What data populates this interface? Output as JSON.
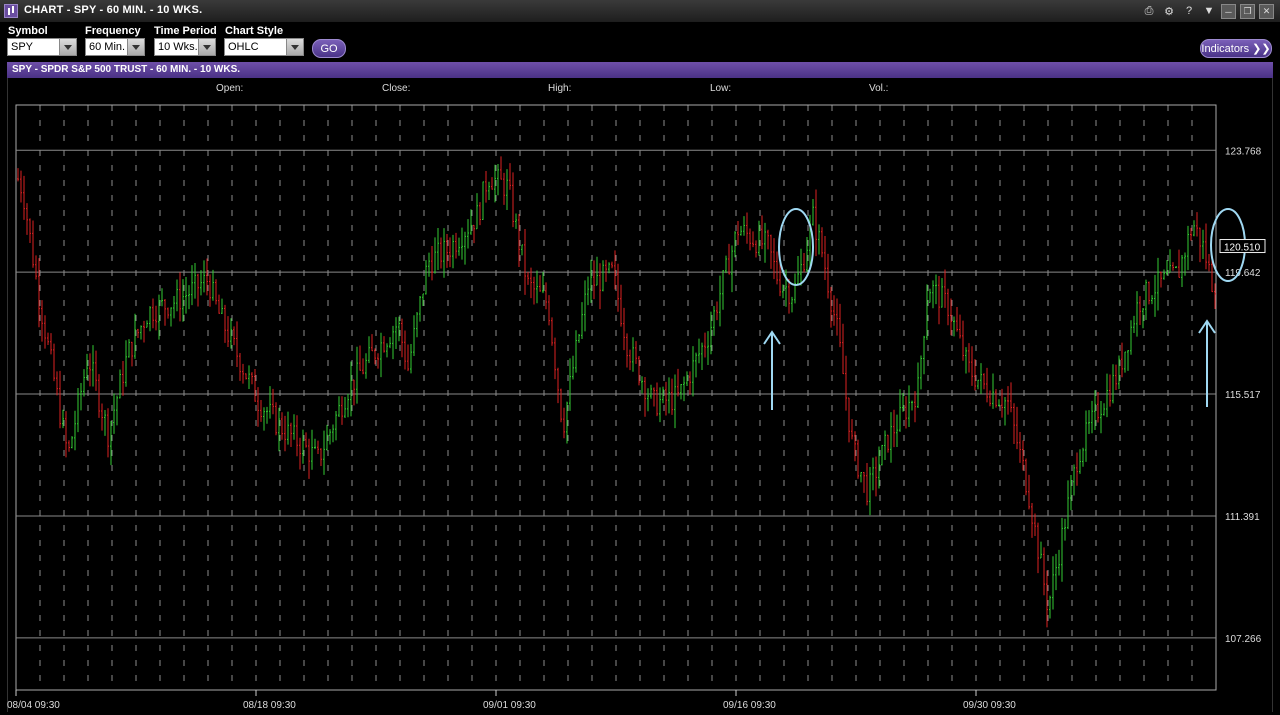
{
  "window": {
    "title": "CHART - SPY - 60 MIN. - 10 WKS.",
    "icons": [
      "print-icon",
      "settings-icon",
      "help-icon",
      "dropdown-icon",
      "minimize-icon",
      "restore-icon",
      "close-icon"
    ]
  },
  "controls": {
    "symbol_label": "Symbol",
    "symbol_value": "SPY",
    "frequency_label": "Frequency",
    "frequency_value": "60 Min.",
    "period_label": "Time Period",
    "period_value": "10 Wks.",
    "style_label": "Chart Style",
    "style_value": "OHLC",
    "go_label": "GO",
    "indicators_label": "Indicators ❯❯"
  },
  "chart_header": "SPY - SPDR S&P 500 TRUST - 60 MIN. - 10 WKS.",
  "ohlc_labels": {
    "open": "Open:",
    "close": "Close:",
    "high": "High:",
    "low": "Low:",
    "vol": "Vol.:"
  },
  "colors": {
    "up": "#33cc33",
    "down": "#dd2222",
    "accent": "#5b3f98",
    "annotation": "#9fd8f2",
    "grid": "#8a8a8a"
  },
  "chart_data": {
    "type": "ohlc",
    "title": "",
    "xlabel": "",
    "ylabel": "",
    "ylim": [
      105.5,
      125.3
    ],
    "yticks": [
      123.768,
      119.642,
      115.517,
      111.391,
      107.266
    ],
    "ytick_labels": [
      "123.768",
      "119.642",
      "115.517",
      "111.391",
      "107.266"
    ],
    "xtick_labels": [
      "08/04 09:30",
      "08/18 09:30",
      "09/01 09:30",
      "09/16 09:30",
      "09/30 09:30"
    ],
    "last_price": "120.510",
    "grid": true,
    "keypoints": [
      [
        0,
        122.8
      ],
      [
        5,
        122.4
      ],
      [
        20,
        119.0
      ],
      [
        50,
        113.4
      ],
      [
        70,
        116.8
      ],
      [
        90,
        114.2
      ],
      [
        110,
        116.9
      ],
      [
        130,
        118.3
      ],
      [
        160,
        118.7
      ],
      [
        190,
        119.4
      ],
      [
        200,
        118.3
      ],
      [
        240,
        115.3
      ],
      [
        260,
        114.5
      ],
      [
        300,
        113.3
      ],
      [
        330,
        115.7
      ],
      [
        360,
        117.1
      ],
      [
        380,
        117.9
      ],
      [
        390,
        116.4
      ],
      [
        410,
        120.0
      ],
      [
        430,
        120.4
      ],
      [
        460,
        121.6
      ],
      [
        470,
        122.9
      ],
      [
        490,
        122.5
      ],
      [
        500,
        120.8
      ],
      [
        510,
        119.2
      ],
      [
        530,
        118.6
      ],
      [
        545,
        114.4
      ],
      [
        555,
        116.4
      ],
      [
        570,
        119.2
      ],
      [
        595,
        119.6
      ],
      [
        610,
        117.1
      ],
      [
        635,
        115.2
      ],
      [
        660,
        115.4
      ],
      [
        690,
        117.5
      ],
      [
        720,
        121.1
      ],
      [
        750,
        120.5
      ],
      [
        760,
        119.4
      ],
      [
        775,
        118.9
      ],
      [
        785,
        120.0
      ],
      [
        795,
        121.5
      ],
      [
        805,
        120.2
      ],
      [
        820,
        117.5
      ],
      [
        835,
        113.6
      ],
      [
        850,
        112.2
      ],
      [
        870,
        114.0
      ],
      [
        900,
        115.7
      ],
      [
        910,
        119.2
      ],
      [
        930,
        118.5
      ],
      [
        950,
        116.4
      ],
      [
        965,
        115.8
      ],
      [
        990,
        115.2
      ],
      [
        1010,
        112.3
      ],
      [
        1020,
        110.3
      ],
      [
        1030,
        108.3
      ],
      [
        1040,
        110.0
      ],
      [
        1060,
        113.5
      ],
      [
        1080,
        115.0
      ],
      [
        1100,
        116.2
      ],
      [
        1120,
        118.6
      ],
      [
        1135,
        119.1
      ],
      [
        1160,
        119.6
      ],
      [
        1175,
        121.3
      ],
      [
        1185,
        120.5
      ],
      [
        1195,
        119.2
      ],
      [
        1215,
        120.5
      ]
    ]
  }
}
